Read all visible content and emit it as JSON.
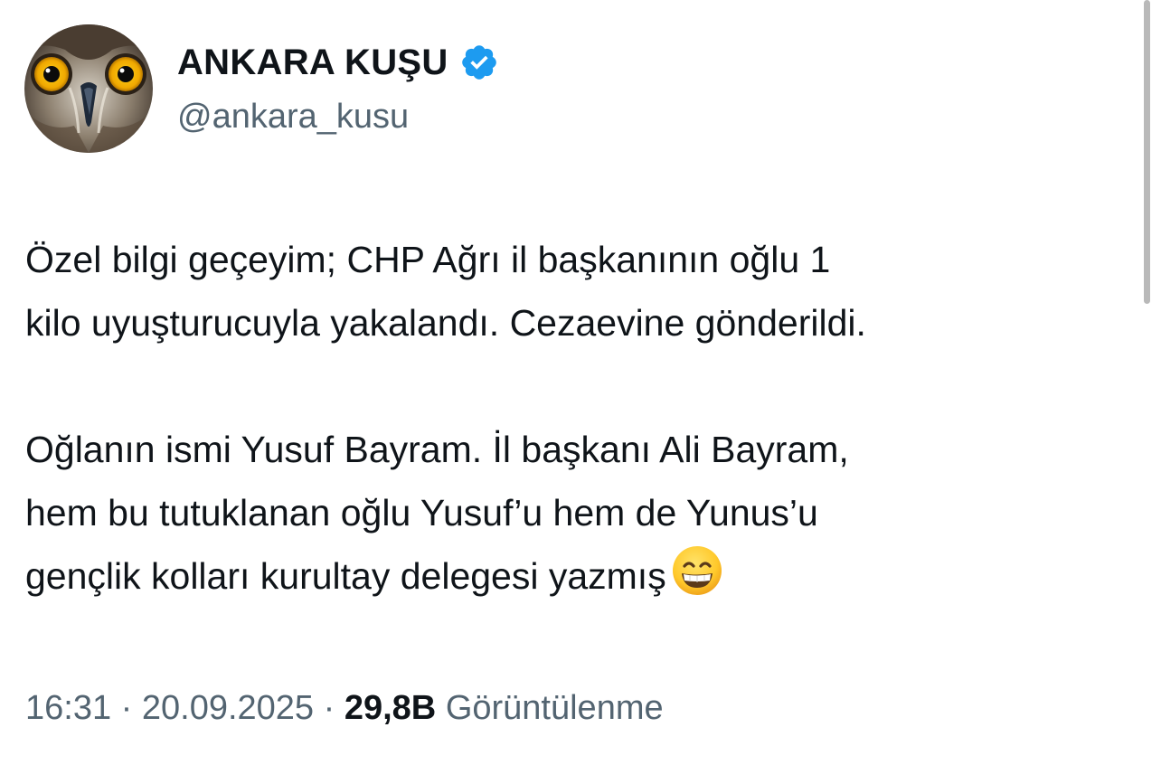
{
  "profile": {
    "display_name": "ANKARA KUŞU",
    "handle": "@ankara_kusu",
    "verified": true,
    "avatar_icon": "owl-face-avatar",
    "verified_icon": "verified-badge-icon",
    "verified_color": "#1d9bf0"
  },
  "tweet": {
    "paragraph_1": "Özel bilgi geçeyim; CHP Ağrı il başkanının oğlu 1\nkilo uyuşturucuyla yakalandı. Cezaevine gönderildi.",
    "paragraph_2": "Oğlanın ismi Yusuf Bayram. İl başkanı Ali Bayram,\nhem bu tutuklanan oğlu Yusuf’u hem de Yunus’u\ngençlik kolları kurultay delegesi yazmış",
    "emoji_icon": "grinning-face-emoji"
  },
  "meta": {
    "time": "16:31",
    "separator": " · ",
    "date": "20.09.2025",
    "views_count": "29,8B",
    "views_label": "Görüntülenme"
  },
  "colors": {
    "text_primary": "#0f1419",
    "text_secondary": "#536471",
    "accent": "#1d9bf0"
  }
}
